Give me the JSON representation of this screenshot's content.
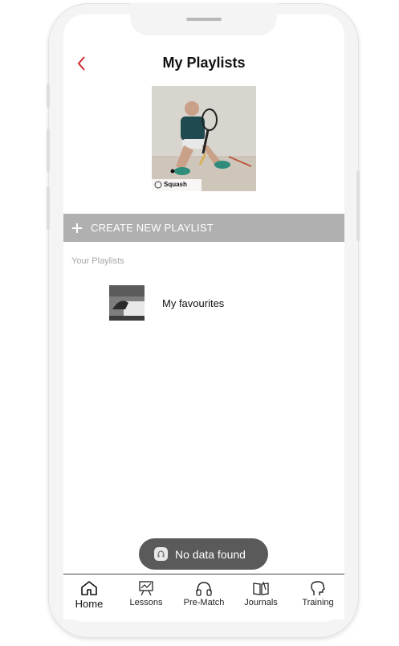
{
  "header": {
    "title": "My Playlists"
  },
  "cover": {
    "watermark": "Squash"
  },
  "actions": {
    "create_playlist": "CREATE NEW PLAYLIST"
  },
  "playlists": {
    "section_label": "Your Playlists",
    "items": [
      {
        "name": "My favourites"
      }
    ]
  },
  "toast": {
    "message": "No data found"
  },
  "tabs": [
    {
      "label": "Home",
      "icon": "home-icon",
      "active": true
    },
    {
      "label": "Lessons",
      "icon": "presentation-icon"
    },
    {
      "label": "Pre-Match",
      "icon": "headphones-icon"
    },
    {
      "label": "Journals",
      "icon": "book-icon"
    },
    {
      "label": "Training",
      "icon": "head-icon"
    }
  ],
  "colors": {
    "accent": "#cc2b2b",
    "create_bar": "#b0b0b0",
    "toast_bg": "#5a5a5a"
  }
}
